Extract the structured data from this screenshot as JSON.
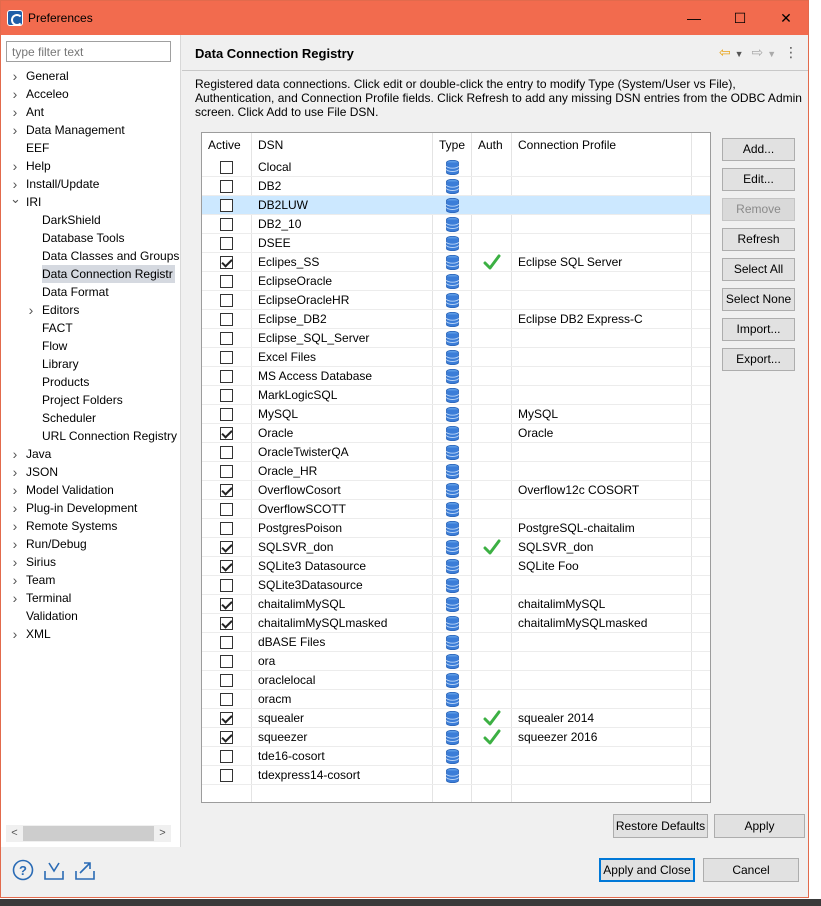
{
  "window": {
    "title": "Preferences",
    "min_glyph": "—",
    "max_glyph": "☐",
    "close_glyph": "✕"
  },
  "sidebar": {
    "filter_placeholder": "type filter text",
    "items": [
      {
        "label": "General",
        "level": 0,
        "twisty": ">"
      },
      {
        "label": "Acceleo",
        "level": 0,
        "twisty": ">"
      },
      {
        "label": "Ant",
        "level": 0,
        "twisty": ">"
      },
      {
        "label": "Data Management",
        "level": 0,
        "twisty": ">"
      },
      {
        "label": "EEF",
        "level": 0,
        "twisty": ""
      },
      {
        "label": "Help",
        "level": 0,
        "twisty": ">"
      },
      {
        "label": "Install/Update",
        "level": 0,
        "twisty": ">"
      },
      {
        "label": "IRI",
        "level": 0,
        "twisty": "v"
      },
      {
        "label": "DarkShield",
        "level": 1,
        "twisty": ""
      },
      {
        "label": "Database Tools",
        "level": 1,
        "twisty": ""
      },
      {
        "label": "Data Classes and Groups",
        "level": 1,
        "twisty": ""
      },
      {
        "label": "Data Connection Registr",
        "level": 1,
        "twisty": "",
        "selected": true
      },
      {
        "label": "Data Format",
        "level": 1,
        "twisty": ""
      },
      {
        "label": "Editors",
        "level": 1,
        "twisty": ">"
      },
      {
        "label": "FACT",
        "level": 1,
        "twisty": ""
      },
      {
        "label": "Flow",
        "level": 1,
        "twisty": ""
      },
      {
        "label": "Library",
        "level": 1,
        "twisty": ""
      },
      {
        "label": "Products",
        "level": 1,
        "twisty": ""
      },
      {
        "label": "Project Folders",
        "level": 1,
        "twisty": ""
      },
      {
        "label": "Scheduler",
        "level": 1,
        "twisty": ""
      },
      {
        "label": "URL Connection Registry",
        "level": 1,
        "twisty": ""
      },
      {
        "label": "Java",
        "level": 0,
        "twisty": ">"
      },
      {
        "label": "JSON",
        "level": 0,
        "twisty": ">"
      },
      {
        "label": "Model Validation",
        "level": 0,
        "twisty": ">"
      },
      {
        "label": "Plug-in Development",
        "level": 0,
        "twisty": ">"
      },
      {
        "label": "Remote Systems",
        "level": 0,
        "twisty": ">"
      },
      {
        "label": "Run/Debug",
        "level": 0,
        "twisty": ">"
      },
      {
        "label": "Sirius",
        "level": 0,
        "twisty": ">"
      },
      {
        "label": "Team",
        "level": 0,
        "twisty": ">"
      },
      {
        "label": "Terminal",
        "level": 0,
        "twisty": ">"
      },
      {
        "label": "Validation",
        "level": 0,
        "twisty": ""
      },
      {
        "label": "XML",
        "level": 0,
        "twisty": ">"
      }
    ],
    "scroll_left": "<",
    "scroll_right": ">"
  },
  "page": {
    "title": "Data Connection Registry",
    "description": "Registered data connections. Click edit or double-click the entry to modify Type (System/User vs File), Authentication, and Connection Profile fields. Click Refresh to add any missing DSN entries from the ODBC Admin screen. Click Add to use File DSN.",
    "columns": [
      "Active",
      "DSN",
      "Type",
      "Auth",
      "Connection Profile"
    ],
    "rows": [
      {
        "active": false,
        "dsn": "Clocal",
        "auth": false,
        "profile": ""
      },
      {
        "active": false,
        "dsn": "DB2",
        "auth": false,
        "profile": ""
      },
      {
        "active": false,
        "dsn": "DB2LUW",
        "auth": false,
        "profile": "",
        "selected": true
      },
      {
        "active": false,
        "dsn": "DB2_10",
        "auth": false,
        "profile": ""
      },
      {
        "active": false,
        "dsn": "DSEE",
        "auth": false,
        "profile": ""
      },
      {
        "active": true,
        "dsn": "Eclipes_SS",
        "auth": true,
        "profile": "Eclipse SQL Server"
      },
      {
        "active": false,
        "dsn": "EclipseOracle",
        "auth": false,
        "profile": ""
      },
      {
        "active": false,
        "dsn": "EclipseOracleHR",
        "auth": false,
        "profile": ""
      },
      {
        "active": false,
        "dsn": "Eclipse_DB2",
        "auth": false,
        "profile": "Eclipse DB2 Express-C"
      },
      {
        "active": false,
        "dsn": "Eclipse_SQL_Server",
        "auth": false,
        "profile": ""
      },
      {
        "active": false,
        "dsn": "Excel Files",
        "auth": false,
        "profile": ""
      },
      {
        "active": false,
        "dsn": "MS Access Database",
        "auth": false,
        "profile": ""
      },
      {
        "active": false,
        "dsn": "MarkLogicSQL",
        "auth": false,
        "profile": ""
      },
      {
        "active": false,
        "dsn": "MySQL",
        "auth": false,
        "profile": "MySQL"
      },
      {
        "active": true,
        "dsn": "Oracle",
        "auth": false,
        "profile": "Oracle"
      },
      {
        "active": false,
        "dsn": "OracleTwisterQA",
        "auth": false,
        "profile": ""
      },
      {
        "active": false,
        "dsn": "Oracle_HR",
        "auth": false,
        "profile": ""
      },
      {
        "active": true,
        "dsn": "OverflowCosort",
        "auth": false,
        "profile": "Overflow12c COSORT"
      },
      {
        "active": false,
        "dsn": "OverflowSCOTT",
        "auth": false,
        "profile": ""
      },
      {
        "active": false,
        "dsn": "PostgresPoison",
        "auth": false,
        "profile": "PostgreSQL-chaitalim"
      },
      {
        "active": true,
        "dsn": "SQLSVR_don",
        "auth": true,
        "profile": "SQLSVR_don"
      },
      {
        "active": true,
        "dsn": "SQLite3 Datasource",
        "auth": false,
        "profile": "SQLite Foo"
      },
      {
        "active": false,
        "dsn": "SQLite3Datasource",
        "auth": false,
        "profile": ""
      },
      {
        "active": true,
        "dsn": "chaitalimMySQL",
        "auth": false,
        "profile": "chaitalimMySQL"
      },
      {
        "active": true,
        "dsn": "chaitalimMySQLmasked",
        "auth": false,
        "profile": "chaitalimMySQLmasked"
      },
      {
        "active": false,
        "dsn": "dBASE Files",
        "auth": false,
        "profile": ""
      },
      {
        "active": false,
        "dsn": "ora",
        "auth": false,
        "profile": ""
      },
      {
        "active": false,
        "dsn": "oraclelocal",
        "auth": false,
        "profile": ""
      },
      {
        "active": false,
        "dsn": "oracm",
        "auth": false,
        "profile": ""
      },
      {
        "active": true,
        "dsn": "squealer",
        "auth": true,
        "profile": "squealer 2014"
      },
      {
        "active": true,
        "dsn": "squeezer",
        "auth": true,
        "profile": "squeezer 2016"
      },
      {
        "active": false,
        "dsn": "tde16-cosort",
        "auth": false,
        "profile": ""
      },
      {
        "active": false,
        "dsn": "tdexpress14-cosort",
        "auth": false,
        "profile": ""
      }
    ],
    "side_buttons": {
      "add": "Add...",
      "edit": "Edit...",
      "remove": "Remove",
      "refresh": "Refresh",
      "select_all": "Select All",
      "select_none": "Select None",
      "import": "Import...",
      "export": "Export..."
    },
    "restore_defaults": "Restore Defaults",
    "apply": "Apply"
  },
  "footer": {
    "apply_and_close": "Apply and Close",
    "cancel": "Cancel"
  },
  "colors": {
    "titlebar": "#f26b4e",
    "selection": "#cce8ff",
    "db_icon": "#3b7dd8",
    "auth_check": "#3cb043"
  }
}
